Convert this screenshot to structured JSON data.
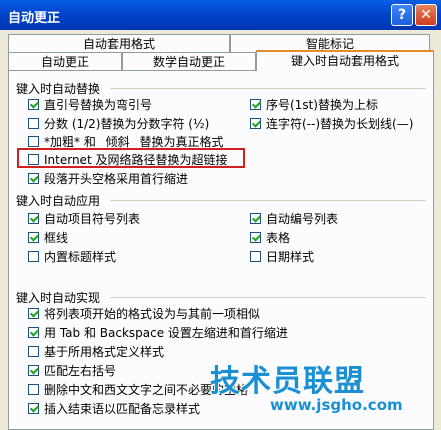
{
  "window": {
    "title": "自动更正",
    "help_label": "?",
    "close_label": "✕"
  },
  "tabs": {
    "row1": [
      "自动套用格式",
      "智能标记"
    ],
    "row2": [
      "自动更正",
      "数学自动更正",
      "键入时自动套用格式"
    ]
  },
  "sections": {
    "replace": {
      "title": "键入时自动替换",
      "left": [
        {
          "label": "直引号替换为弯引号",
          "checked": true
        },
        {
          "label": "分数 (1/2)替换为分数字符 (½)",
          "checked": false
        },
        {
          "label": "*加粗* 和 _倾斜_ 替换为真正格式",
          "checked": false
        },
        {
          "label": "Internet 及网络路径替换为超链接",
          "checked": false
        },
        {
          "label": "段落开头空格采用首行缩进",
          "checked": true
        }
      ],
      "right": [
        {
          "label": "序号(1st)替换为上标",
          "checked": true
        },
        {
          "label": "连字符(--)替换为长划线(—)",
          "checked": true
        }
      ]
    },
    "apply": {
      "title": "键入时自动应用",
      "left": [
        {
          "label": "自动项目符号列表",
          "checked": true
        },
        {
          "label": "框线",
          "checked": true
        },
        {
          "label": "内置标题样式",
          "checked": false
        }
      ],
      "right": [
        {
          "label": "自动编号列表",
          "checked": true
        },
        {
          "label": "表格",
          "checked": true
        },
        {
          "label": "日期样式",
          "checked": false
        }
      ]
    },
    "implement": {
      "title": "键入时自动实现",
      "items": [
        {
          "label": "将列表项开始的格式设为与其前一项相似",
          "checked": true
        },
        {
          "label": "用 Tab 和 Backspace 设置左缩进和首行缩进",
          "checked": true
        },
        {
          "label": "基于所用格式定义样式",
          "checked": false
        },
        {
          "label": "匹配左右括号",
          "checked": true
        },
        {
          "label": "删除中文和西文文字之间不必要的空格",
          "checked": false
        },
        {
          "label": "插入结束语以匹配备忘录样式",
          "checked": true
        }
      ]
    }
  },
  "watermark": {
    "title": "技术员联盟",
    "url": "www.jsgho.com"
  }
}
